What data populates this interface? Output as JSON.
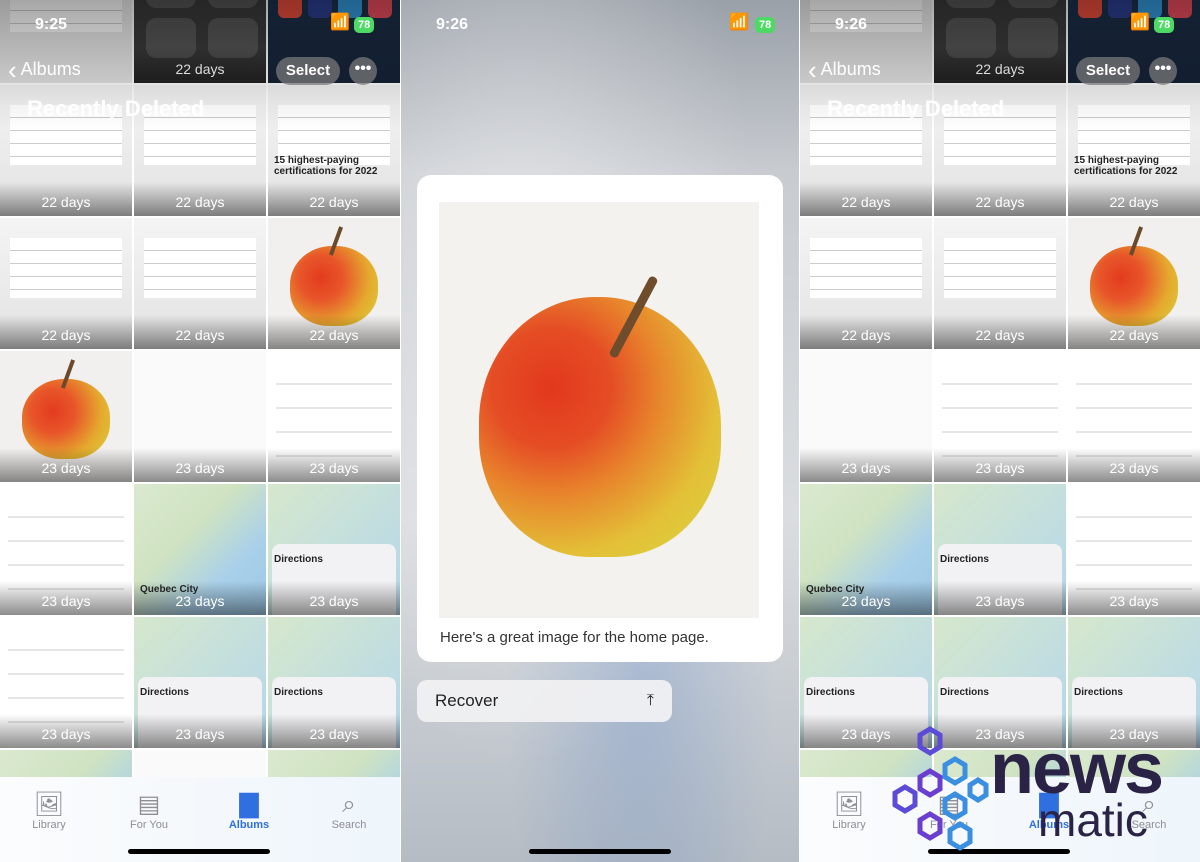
{
  "left": {
    "status_time": "9:25",
    "battery": "78",
    "back_label": "Albums",
    "title": "Recently Deleted",
    "select_label": "Select",
    "more_label": "•••",
    "cells": [
      {
        "type": "screen",
        "days": ""
      },
      {
        "type": "dark",
        "days": "22 days"
      },
      {
        "type": "icons",
        "days": ""
      },
      {
        "type": "screen",
        "days": "22 days"
      },
      {
        "type": "screen",
        "days": "22 days"
      },
      {
        "type": "screen",
        "days": "22 days",
        "title": "15 highest-paying certifications for 2022"
      },
      {
        "type": "screen",
        "days": "22 days"
      },
      {
        "type": "screen",
        "days": "22 days"
      },
      {
        "type": "apple",
        "days": "22 days"
      },
      {
        "type": "apple",
        "days": "23 days"
      },
      {
        "type": "white",
        "days": "23 days"
      },
      {
        "type": "list",
        "days": "23 days"
      },
      {
        "type": "list",
        "days": "23 days"
      },
      {
        "type": "map",
        "days": "23 days",
        "title": "Quebec City"
      },
      {
        "type": "dir",
        "days": "23 days",
        "title": "Directions"
      },
      {
        "type": "list",
        "days": "23 days"
      },
      {
        "type": "dir",
        "days": "23 days",
        "title": "Directions"
      },
      {
        "type": "dir",
        "days": "23 days",
        "title": "Directions"
      },
      {
        "type": "map",
        "days": ""
      },
      {
        "type": "white",
        "days": ""
      },
      {
        "type": "map",
        "days": ""
      }
    ]
  },
  "right": {
    "status_time": "9:26",
    "battery": "78",
    "back_label": "Albums",
    "title": "Recently Deleted",
    "select_label": "Select",
    "more_label": "•••",
    "cells": [
      {
        "type": "screen",
        "days": ""
      },
      {
        "type": "dark",
        "days": "22 days"
      },
      {
        "type": "icons",
        "days": ""
      },
      {
        "type": "screen",
        "days": "22 days"
      },
      {
        "type": "screen",
        "days": "22 days"
      },
      {
        "type": "screen",
        "days": "22 days",
        "title": "15 highest-paying certifications for 2022"
      },
      {
        "type": "screen",
        "days": "22 days"
      },
      {
        "type": "screen",
        "days": "22 days"
      },
      {
        "type": "apple",
        "days": "22 days"
      },
      {
        "type": "white",
        "days": "23 days"
      },
      {
        "type": "list",
        "days": "23 days"
      },
      {
        "type": "list",
        "days": "23 days"
      },
      {
        "type": "map",
        "days": "23 days",
        "title": "Quebec City"
      },
      {
        "type": "dir",
        "days": "23 days",
        "title": "Directions"
      },
      {
        "type": "list",
        "days": "23 days"
      },
      {
        "type": "dir",
        "days": "23 days",
        "title": "Directions"
      },
      {
        "type": "dir",
        "days": "23 days",
        "title": "Directions"
      },
      {
        "type": "dir",
        "days": "23 days",
        "title": "Directions"
      },
      {
        "type": "map",
        "days": ""
      },
      {
        "type": "map",
        "days": ""
      },
      {
        "type": "map",
        "days": ""
      }
    ]
  },
  "middle": {
    "status_time": "9:26",
    "battery": "78",
    "caption": "Here's a great image for the home page.",
    "recover_label": "Recover",
    "recover_icon": "trash-restore-icon"
  },
  "tabs": [
    {
      "label": "Library",
      "icon": "photo-stack-icon"
    },
    {
      "label": "For You",
      "icon": "for-you-icon"
    },
    {
      "label": "Albums",
      "icon": "albums-icon",
      "active": true
    },
    {
      "label": "Search",
      "icon": "search-icon"
    }
  ],
  "watermark": {
    "line1": "news",
    "line2": "matic"
  },
  "colors": {
    "accent": "#2f6fe0",
    "battery": "#4cd964"
  }
}
